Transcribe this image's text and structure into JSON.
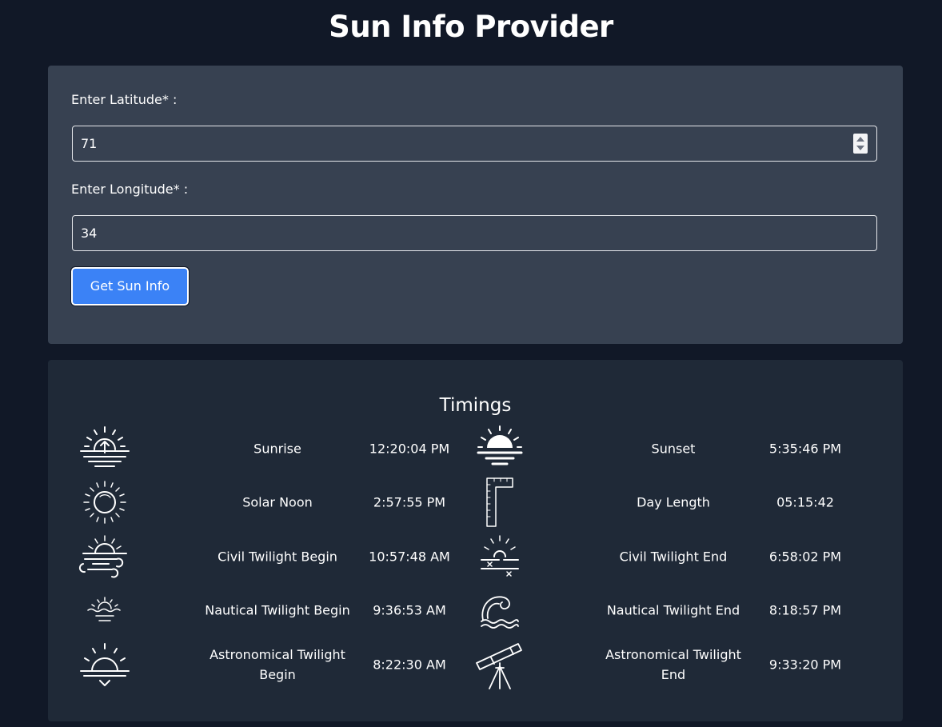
{
  "app": {
    "title": "Sun Info Provider"
  },
  "form": {
    "latitude_label": "Enter Latitude* :",
    "latitude_value": "71",
    "longitude_label": "Enter Longitude* :",
    "longitude_value": "34",
    "submit_label": "Get Sun Info"
  },
  "timings": {
    "title": "Timings",
    "items": [
      {
        "label": "Sunrise",
        "value": "12:20:04 PM",
        "icon": "sunrise-icon"
      },
      {
        "label": "Sunset",
        "value": "5:35:46 PM",
        "icon": "sunset-icon"
      },
      {
        "label": "Solar Noon",
        "value": "2:57:55 PM",
        "icon": "sun-icon"
      },
      {
        "label": "Day Length",
        "value": "05:15:42",
        "icon": "ruler-icon"
      },
      {
        "label": "Civil Twilight Begin",
        "value": "10:57:48 AM",
        "icon": "windy-sunrise-icon"
      },
      {
        "label": "Civil Twilight End",
        "value": "6:58:02 PM",
        "icon": "horizon-sun-icon"
      },
      {
        "label": "Nautical Twilight Begin",
        "value": "9:36:53 AM",
        "icon": "sea-sunrise-icon"
      },
      {
        "label": "Nautical Twilight End",
        "value": "8:18:57 PM",
        "icon": "wave-icon"
      },
      {
        "label": "Astronomical Twilight Begin",
        "value": "8:22:30 AM",
        "icon": "sundown-icon"
      },
      {
        "label": "Astronomical Twilight End",
        "value": "9:33:20 PM",
        "icon": "telescope-icon"
      }
    ]
  },
  "colors": {
    "page_bg": "#111827",
    "form_card_bg": "#374151",
    "timings_card_bg": "#1f2937",
    "button_bg": "#3b82f6",
    "text": "#ffffff"
  }
}
